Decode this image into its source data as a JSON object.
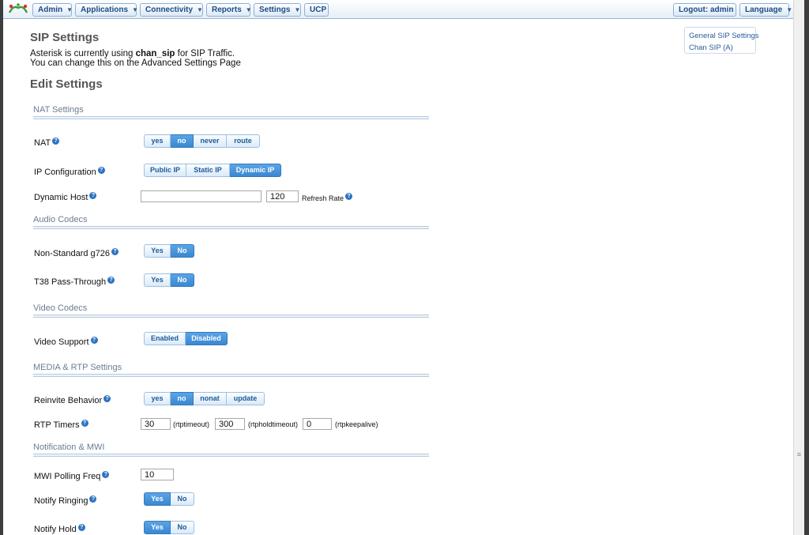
{
  "nav": {
    "admin": "Admin",
    "applications": "Applications",
    "connectivity": "Connectivity",
    "reports": "Reports",
    "settings": "Settings",
    "ucp": "UCP",
    "logout": "Logout: admin",
    "language": "Language",
    "caret": "▼"
  },
  "page": {
    "title": "SIP Settings",
    "intro_prefix": "Asterisk is currently using ",
    "intro_driver": "chan_sip",
    "intro_suffix": " for SIP Traffic.",
    "intro_line2": "You can change this on the Advanced Settings Page",
    "edit_title": "Edit Settings"
  },
  "sidebox": {
    "links": [
      "General SIP Settings",
      "Chan SIP (A)"
    ]
  },
  "sections": {
    "nat": "NAT Settings",
    "audio": "Audio Codecs",
    "video": "Video Codecs",
    "media": "MEDIA & RTP Settings",
    "notify": "Notification & MWI"
  },
  "help_glyph": "?",
  "fields": {
    "nat": {
      "label": "NAT",
      "options": [
        "yes",
        "no",
        "never",
        "route"
      ],
      "selected": "no"
    },
    "ipconfig": {
      "label": "IP Configuration",
      "options": [
        "Public IP",
        "Static IP",
        "Dynamic IP"
      ],
      "selected": "Dynamic IP"
    },
    "dynhost": {
      "label": "Dynamic Host",
      "value": "",
      "refresh_value": "120",
      "refresh_label": "Refresh Rate"
    },
    "g726": {
      "label": "Non-Standard g726",
      "options": [
        "Yes",
        "No"
      ],
      "selected": "No"
    },
    "t38": {
      "label": "T38 Pass-Through",
      "options": [
        "Yes",
        "No"
      ],
      "selected": "No"
    },
    "video": {
      "label": "Video Support",
      "options": [
        "Enabled",
        "Disabled"
      ],
      "selected": "Disabled"
    },
    "reinvite": {
      "label": "Reinvite Behavior",
      "options": [
        "yes",
        "no",
        "nonat",
        "update"
      ],
      "selected": "no"
    },
    "rtp": {
      "label": "RTP Timers",
      "rtptimeout": "30",
      "rtptimeout_label": "(rtptimeout)",
      "rtpholdtimeout": "300",
      "rtpholdtimeout_label": "(rtpholdtimeout)",
      "rtpkeepalive": "0",
      "rtpkeepalive_label": "(rtpkeepalive)"
    },
    "mwi": {
      "label": "MWI Polling Freq",
      "value": "10"
    },
    "ringing": {
      "label": "Notify Ringing",
      "options": [
        "Yes",
        "No"
      ],
      "selected": "Yes"
    },
    "hold": {
      "label": "Notify Hold",
      "options": [
        "Yes",
        "No"
      ],
      "selected": "Yes"
    }
  },
  "colors": {
    "accent": "#3a88d2",
    "link": "#2a5c9c",
    "nav_text": "#1c4c86"
  }
}
